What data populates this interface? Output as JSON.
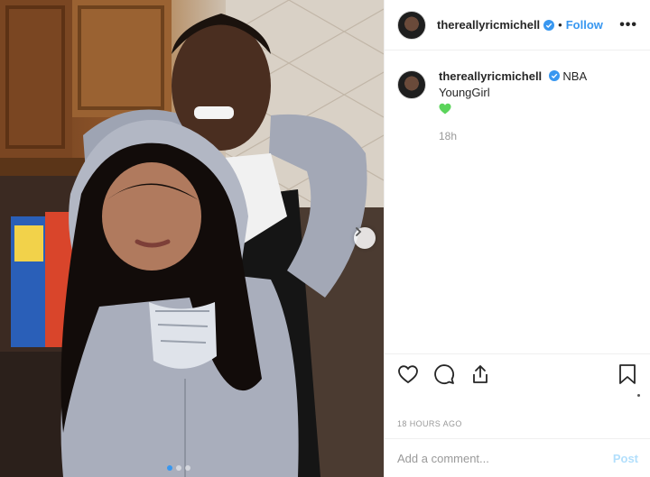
{
  "post": {
    "username": "thereallyricmichell",
    "follow_label": "Follow",
    "separator": "•",
    "more_label": "•••",
    "caption_text": "NBA YoungGirl",
    "caption_time": "18h",
    "timestamp": "18 HOURS AGO",
    "comment_placeholder": "Add a comment...",
    "post_label": "Post"
  },
  "icons": {
    "verified": "verified-badge-icon",
    "like": "heart-icon",
    "comment": "comment-icon",
    "share": "share-icon",
    "save": "bookmark-icon",
    "next": "chevron-right-icon",
    "emoji": "green-heart-emoji"
  },
  "colors": {
    "link": "#3897f0",
    "muted": "#999999",
    "text": "#262626",
    "emoji": "#5bd45b"
  },
  "carousel": {
    "total": 3,
    "active": 1
  }
}
